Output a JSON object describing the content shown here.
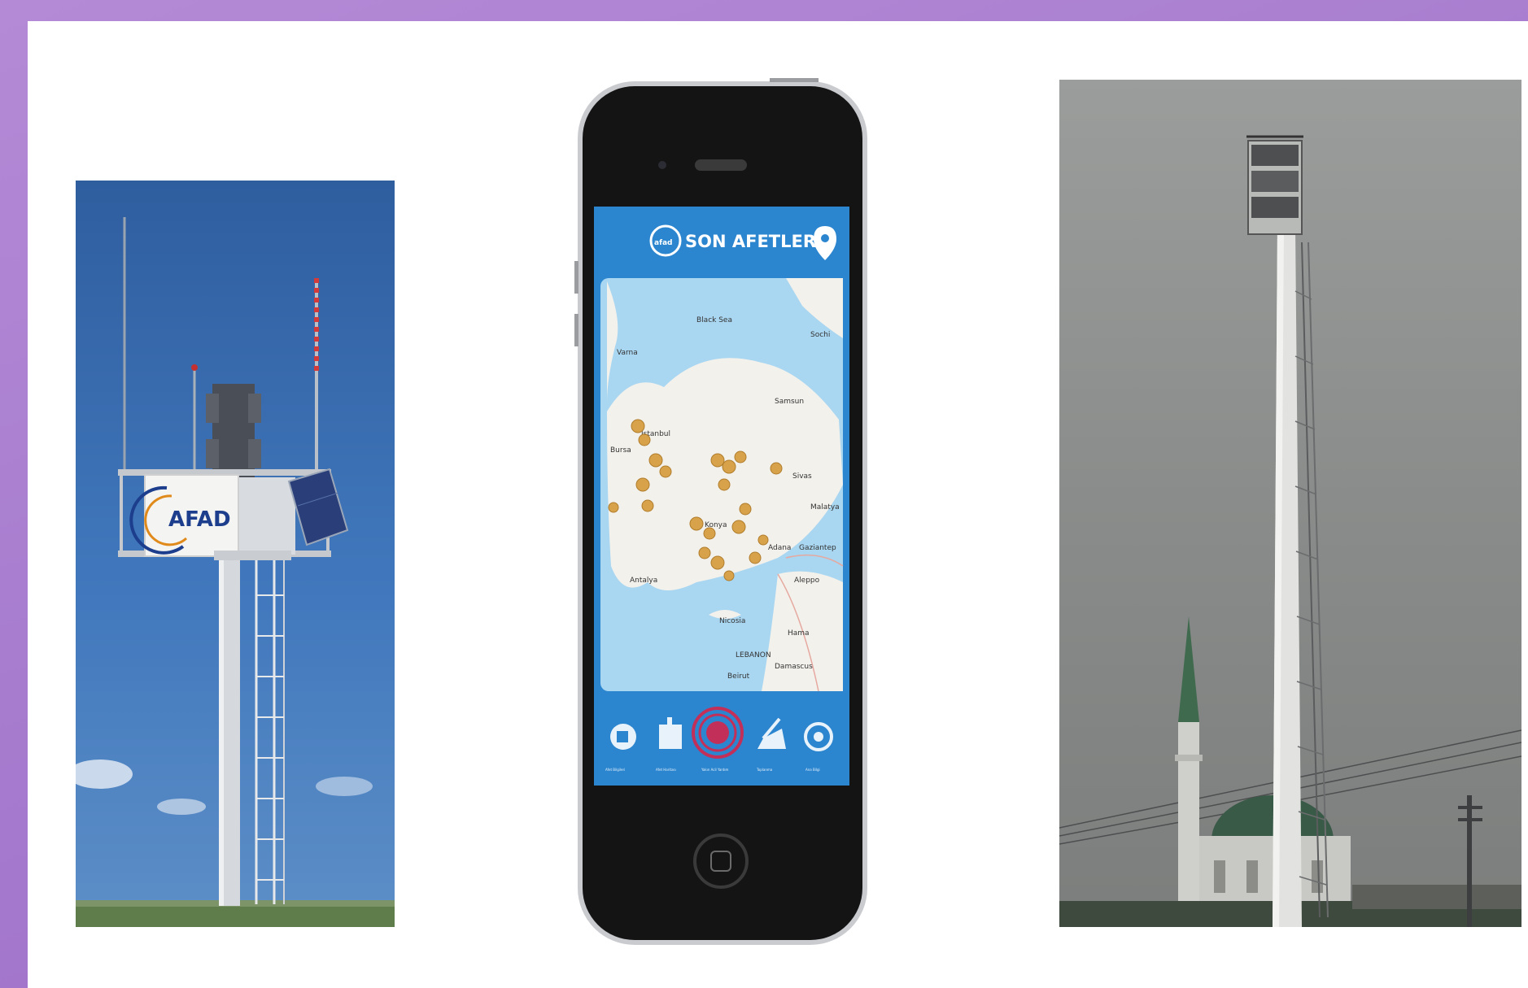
{
  "panels": {
    "siren": {
      "logo_text": "AFAD"
    },
    "phone": {
      "app_title": "SON AFETLER",
      "map_labels": [
        "Black Sea",
        "Varna",
        "Sochi",
        "Samsun",
        "Istanbul",
        "Bursa",
        "Sivas",
        "Malatya",
        "Konya",
        "Adana",
        "Gaziantep",
        "Aleppo",
        "Antalya",
        "Nicosia",
        "Hama",
        "LEBANON",
        "Beirut",
        "Damascus"
      ],
      "bottom_nav": [
        "Afet Bilgileri",
        "Afet Haritası",
        "Yakın Acil Yardım",
        "Toplanma",
        "Ana Bilgi"
      ]
    }
  },
  "colors": {
    "frame": "#a77ccf",
    "sky": "#3d6fb4",
    "app_blue": "#2b86cf",
    "map_water": "#a9d6f1",
    "marker": "#d7a24a"
  }
}
